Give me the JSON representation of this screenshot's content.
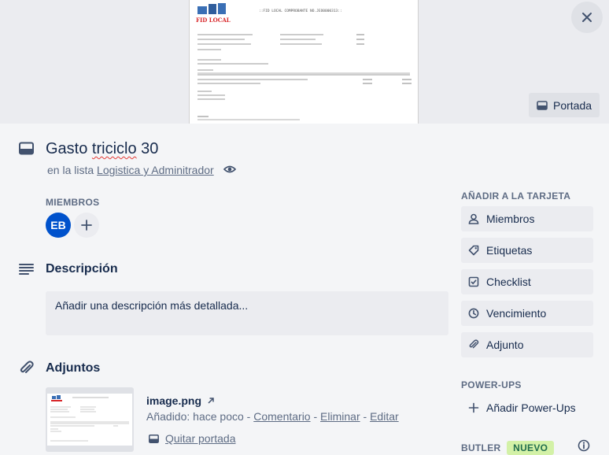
{
  "cover": {
    "doc_logo": "FID LOCAL",
    "doc_header": "::FID LOCAL COMPROBANTE NO.JEO0000313::",
    "portada_label": "Portada"
  },
  "card": {
    "title_plain": "Gasto ",
    "title_misspelled": "triciclo",
    "title_rest": " 30",
    "in_list_prefix": "en la lista ",
    "list_name": "Logistica y Adminitrador"
  },
  "members": {
    "label": "MIEMBROS",
    "avatar_initials": "EB"
  },
  "description": {
    "title": "Descripción",
    "placeholder": "Añadir una descripción más detallada..."
  },
  "attachments": {
    "title": "Adjuntos",
    "items": [
      {
        "name": "image.png",
        "added_prefix": "Añadido: hace poco",
        "sep": " - ",
        "comment": "Comentario",
        "delete": "Eliminar",
        "edit": "Editar",
        "remove_cover": "Quitar portada"
      }
    ]
  },
  "sidebar": {
    "add_to_card_label": "AÑADIR A LA TARJETA",
    "buttons": [
      {
        "label": "Miembros",
        "icon": "person-icon"
      },
      {
        "label": "Etiquetas",
        "icon": "tag-icon"
      },
      {
        "label": "Checklist",
        "icon": "checklist-icon"
      },
      {
        "label": "Vencimiento",
        "icon": "clock-icon"
      },
      {
        "label": "Adjunto",
        "icon": "paperclip-icon"
      }
    ],
    "powerups_label": "POWER-UPS",
    "add_powerups": "Añadir Power-Ups",
    "butler_label": "BUTLER",
    "butler_badge": "NUEVO"
  },
  "colors": {
    "avatar": "#0052cc",
    "badge_bg": "#d3f1a7",
    "panel_bg": "#f4f5f7"
  }
}
